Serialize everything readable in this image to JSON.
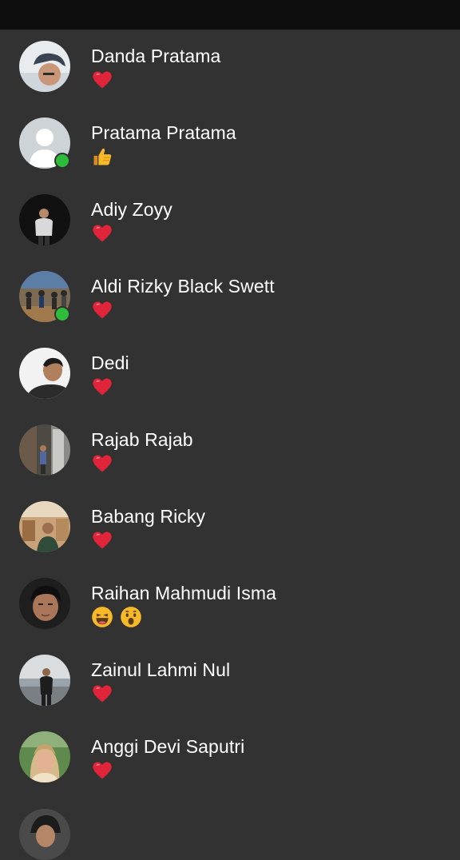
{
  "reactions_list": [
    {
      "name": "Danda Pratama",
      "reactions": [
        "heart"
      ],
      "online": false,
      "avatar": "photo"
    },
    {
      "name": "Pratama Pratama",
      "reactions": [
        "thumbs-up"
      ],
      "online": true,
      "avatar": "default"
    },
    {
      "name": "Adiy Zoyy",
      "reactions": [
        "heart"
      ],
      "online": false,
      "avatar": "photo"
    },
    {
      "name": "Aldi Rizky Black Swett",
      "reactions": [
        "heart"
      ],
      "online": true,
      "avatar": "photo"
    },
    {
      "name": "Dedi",
      "reactions": [
        "heart"
      ],
      "online": false,
      "avatar": "photo"
    },
    {
      "name": "Rajab Rajab",
      "reactions": [
        "heart"
      ],
      "online": false,
      "avatar": "photo"
    },
    {
      "name": "Babang Ricky",
      "reactions": [
        "heart"
      ],
      "online": false,
      "avatar": "photo"
    },
    {
      "name": "Raihan Mahmudi Isma",
      "reactions": [
        "haha",
        "wow"
      ],
      "online": false,
      "avatar": "photo"
    },
    {
      "name": "Zainul Lahmi Nul",
      "reactions": [
        "heart"
      ],
      "online": false,
      "avatar": "photo"
    },
    {
      "name": "Anggi Devi Saputri",
      "reactions": [
        "heart"
      ],
      "online": false,
      "avatar": "photo"
    }
  ],
  "colors": {
    "background": "#323232",
    "status_bar": "#0e0e0e",
    "online_dot": "#2dbd3a",
    "heart": "#e0243a",
    "emoji_yellow": "#f7b928"
  }
}
